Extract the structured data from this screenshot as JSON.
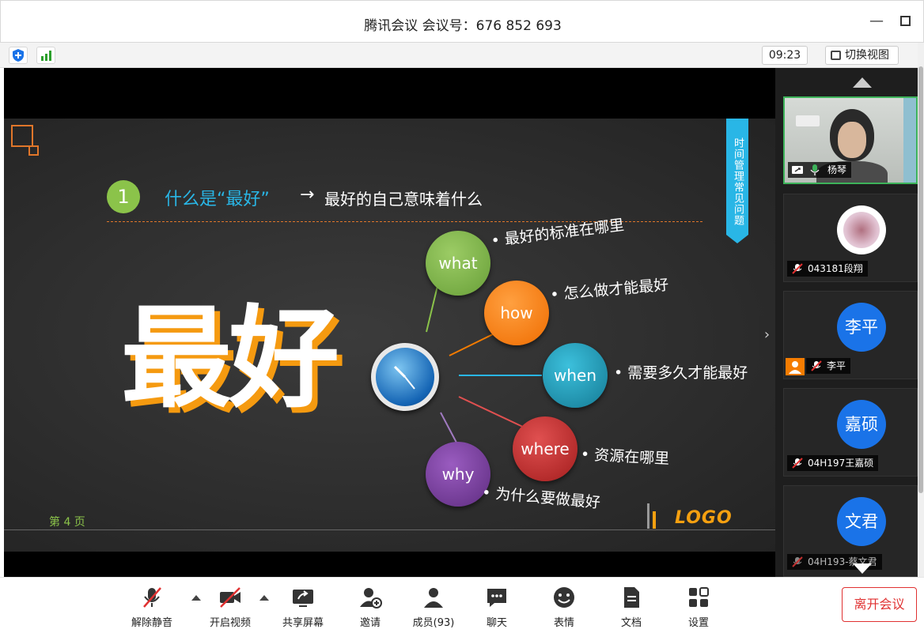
{
  "window": {
    "title": "腾讯会议 会议号：676 852 693"
  },
  "toolbar": {
    "time": "09:23",
    "switch_view": "切换视图"
  },
  "slide": {
    "number_badge": "1",
    "heading_highlight": "什么是“最好”",
    "heading_arrow": "→",
    "heading_rest": "最好的自己意味着什么",
    "big_text": "最好",
    "side_banner": "时间管理常见问题",
    "page_label": "第 4 页",
    "logo": "LOGO",
    "bubbles": [
      {
        "word": "what",
        "text": "最好的标准在哪里",
        "color": "#7cb342"
      },
      {
        "word": "how",
        "text": "怎么做才能最好",
        "color": "#f57c00"
      },
      {
        "word": "when",
        "text": "需要多久才能最好",
        "color": "#1e9cb8"
      },
      {
        "word": "where",
        "text": "资源在哪里",
        "color": "#c62828"
      },
      {
        "word": "why",
        "text": "为什么要做最好",
        "color": "#7b3f9e"
      }
    ]
  },
  "participants": [
    {
      "name": "杨琴",
      "muted": false
    },
    {
      "name": "043181段翔",
      "muted": true
    },
    {
      "name": "李平",
      "avatar": "李平",
      "muted": true
    },
    {
      "name": "04H197王嘉硕",
      "avatar": "嘉硕",
      "muted": true
    },
    {
      "name": "04H193-蔡文君",
      "avatar": "文君",
      "muted": true
    }
  ],
  "controls": {
    "unmute": "解除静音",
    "start_video": "开启视频",
    "share_screen": "共享屏幕",
    "invite": "邀请",
    "members": "成员(93)",
    "chat": "聊天",
    "reactions": "表情",
    "docs": "文档",
    "settings": "设置",
    "leave": "离开会议"
  },
  "colors": {
    "accent_blue": "#1a73e8",
    "leave_red": "#e03131",
    "slide_cyan": "#29b6e6"
  }
}
